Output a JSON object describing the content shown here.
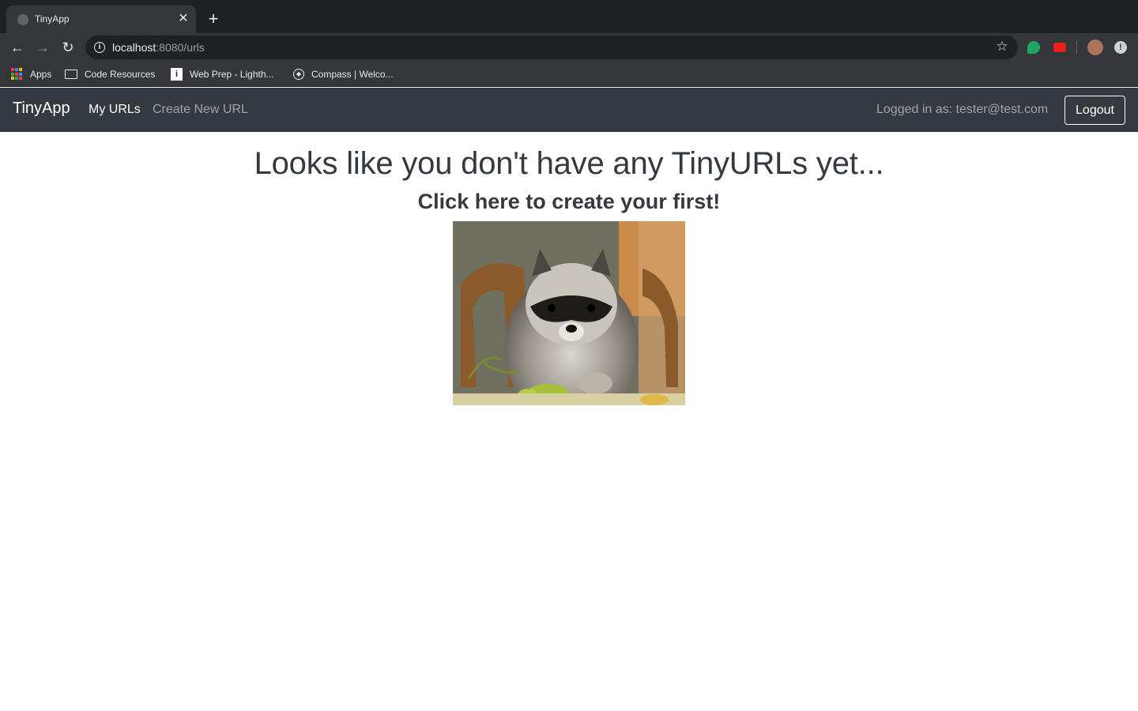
{
  "browser": {
    "tab_title": "TinyApp",
    "url_host": "localhost",
    "url_rest": ":8080/urls",
    "bookmarks": [
      {
        "label": "Apps",
        "icon": "apps-grid-icon"
      },
      {
        "label": "Code Resources",
        "icon": "folder-icon"
      },
      {
        "label": "Web Prep - Lighth...",
        "icon": "lighthouse-icon"
      },
      {
        "label": "Compass | Welco...",
        "icon": "compass-icon"
      }
    ]
  },
  "navbar": {
    "brand": "TinyApp",
    "links": [
      {
        "label": "My URLs",
        "active": true
      },
      {
        "label": "Create New URL",
        "active": false
      }
    ],
    "logged_in_text": "Logged in as: tester@test.com",
    "logout_label": "Logout",
    "background": "#343a40"
  },
  "main": {
    "headline": "Looks like you don't have any TinyURLs yet...",
    "subline": "Click here to create your first!",
    "image_subject": "raccoon-image"
  }
}
